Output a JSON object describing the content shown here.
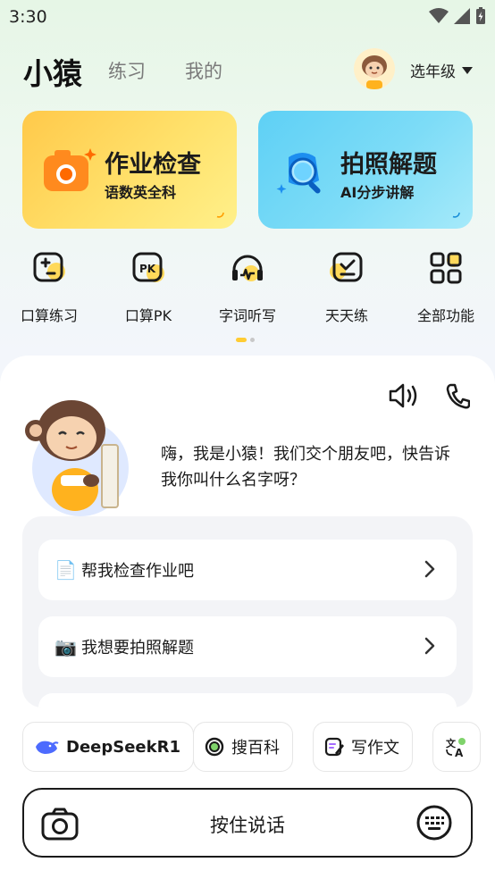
{
  "status": {
    "time": "3:30"
  },
  "header": {
    "brand": "小猿",
    "tabs": [
      {
        "label": "练习"
      },
      {
        "label": "我的"
      }
    ],
    "grade_label": "选年级"
  },
  "hero": [
    {
      "title": "作业检查",
      "subtitle": "语数英全科",
      "icon": "camera-icon",
      "color": "#ffd54a"
    },
    {
      "title": "拍照解题",
      "subtitle": "AI分步讲解",
      "icon": "magnifier-icon",
      "color": "#6fd6f6"
    }
  ],
  "quick": [
    {
      "label": "口算练习",
      "icon": "calc-practice-icon"
    },
    {
      "label": "口算PK",
      "icon": "pk-icon"
    },
    {
      "label": "字词听写",
      "icon": "headphones-icon"
    },
    {
      "label": "天天练",
      "icon": "daily-check-icon"
    },
    {
      "label": "全部功能",
      "icon": "grid-icon"
    }
  ],
  "chat": {
    "greeting": "嗨，我是小猿！我们交个朋友吧，快告诉我你叫什么名字呀？",
    "suggestions": [
      {
        "emoji": "📄",
        "text": "帮我检查作业吧"
      },
      {
        "emoji": "📷",
        "text": "我想要拍照解题"
      }
    ]
  },
  "chips": [
    {
      "label": "DeepSeekR1",
      "icon": "whale-icon"
    },
    {
      "label": "搜百科",
      "icon": "target-icon"
    },
    {
      "label": "写作文",
      "icon": "pen-icon"
    },
    {
      "label": "",
      "icon": "translate-icon"
    }
  ],
  "voice": {
    "label": "按住说话"
  },
  "colors": {
    "accent": "#ffcc33",
    "primary_text": "#1a1a1a",
    "muted": "#7a7a7a"
  }
}
